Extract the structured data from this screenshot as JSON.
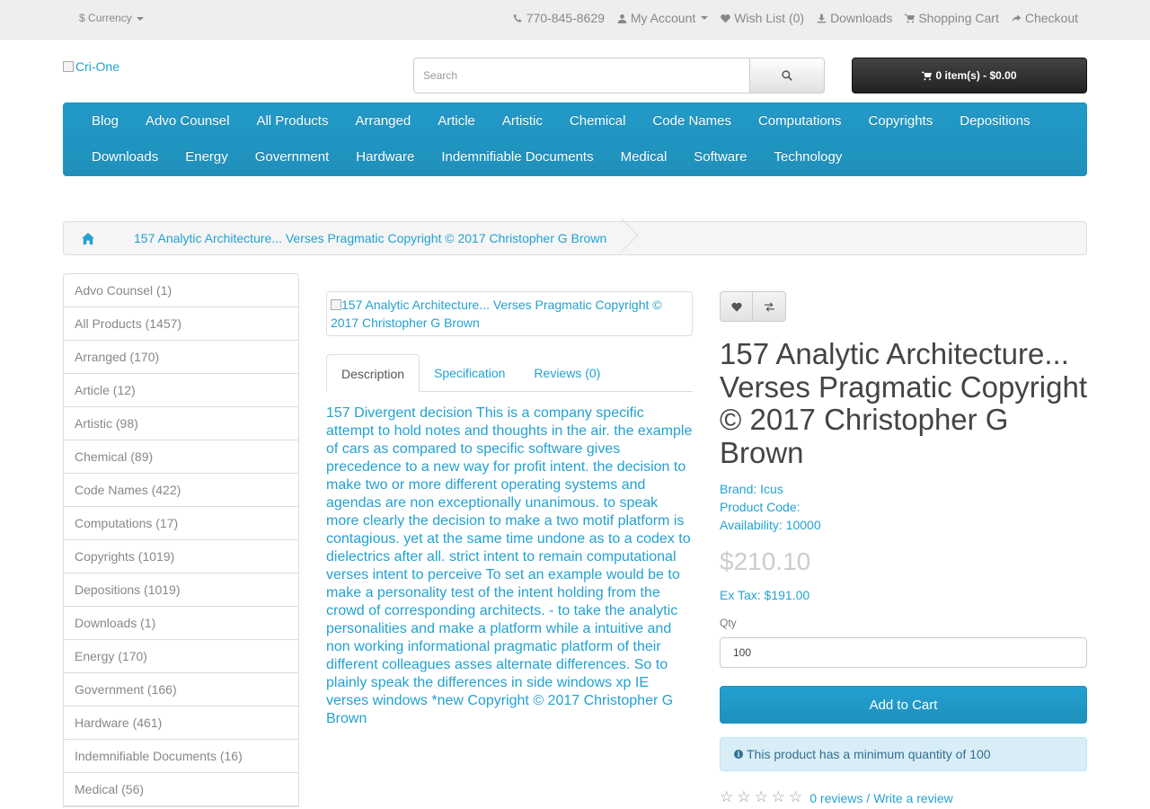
{
  "topbar": {
    "currency_label": "Currency",
    "currency_symbol": "$",
    "phone": "770-845-8629",
    "my_account": "My Account",
    "wish_list": "Wish List (0)",
    "downloads": "Downloads",
    "shopping_cart": "Shopping Cart",
    "checkout": "Checkout"
  },
  "header": {
    "logo_alt": "Cri-One",
    "search_placeholder": "Search",
    "cart_summary": "0 item(s) - $0.00"
  },
  "menu": {
    "row1": [
      "Blog",
      "Advo Counsel",
      "All Products",
      "Arranged",
      "Article",
      "Artistic",
      "Chemical",
      "Code Names",
      "Computations",
      "Copyrights",
      "Depositions"
    ],
    "row2": [
      "Downloads",
      "Energy",
      "Government",
      "Hardware",
      "Indemnifiable Documents",
      "Medical",
      "Software",
      "Technology"
    ]
  },
  "breadcrumb": {
    "current": "157 Analytic Architecture... Verses Pragmatic Copyright © 2017 Christopher G Brown"
  },
  "sidebar": {
    "items": [
      "Advo Counsel (1)",
      "All Products (1457)",
      "Arranged (170)",
      "Article (12)",
      "Artistic (98)",
      "Chemical (89)",
      "Code Names (422)",
      "Computations (17)",
      "Copyrights (1019)",
      "Depositions (1019)",
      "Downloads (1)",
      "Energy (170)",
      "Government (166)",
      "Hardware (461)",
      "Indemnifiable Documents (16)",
      "Medical (56)"
    ]
  },
  "product": {
    "image_alt": "157 Analytic Architecture... Verses Pragmatic Copyright © 2017 Christopher G Brown",
    "title": "157 Analytic Architecture... Verses Pragmatic Copyright © 2017 Christopher G Brown",
    "tabs": [
      "Description",
      "Specification",
      "Reviews (0)"
    ],
    "description": "157 Divergent decision This is a company specific attempt to hold notes and thoughts in the air. the example of cars as compared to specific software gives precedence to a new way for profit intent. the decision to make two or more different operating systems and agendas are non exceptionally unanimous. to speak more clearly the decision to make a two motif platform is contagious. yet at the same time undone as to a codex to dielectrics after all. strict intent to remain computational verses intent to perceive To set an example would be to make a personality test of the intent holding from the crowd of corresponding architects. - to take the analytic personalities and make a platform while a intuitive and non working informational pragmatic platform of their different colleagues asses alternate differences. So to plainly speak the differences in side windows xp IE verses windows *new Copyright © 2017 Christopher G Brown",
    "brand_label": "Brand:",
    "brand": "Icus",
    "product_code_label": "Product Code:",
    "availability_label": "Availability:",
    "availability": "10000",
    "price": "$210.10",
    "ex_tax": "Ex Tax: $191.00",
    "qty_label": "Qty",
    "qty_value": "100",
    "add_to_cart": "Add to Cart",
    "min_qty_notice": "This product has a minimum quantity of 100",
    "reviews_link": "0 reviews",
    "write_review": "Write a review",
    "rating": 0,
    "rating_max": 5
  },
  "colors": {
    "accent": "#23a1d1",
    "menu_bg": "#229ac8",
    "cart_button_bg": "#303030",
    "alert_bg": "#d9edf7"
  },
  "icons": [
    "phone-icon",
    "user-icon",
    "heart-icon",
    "download-icon",
    "cart-icon",
    "share-icon",
    "search-icon",
    "home-icon",
    "exchange-icon",
    "info-icon",
    "star-icon"
  ]
}
